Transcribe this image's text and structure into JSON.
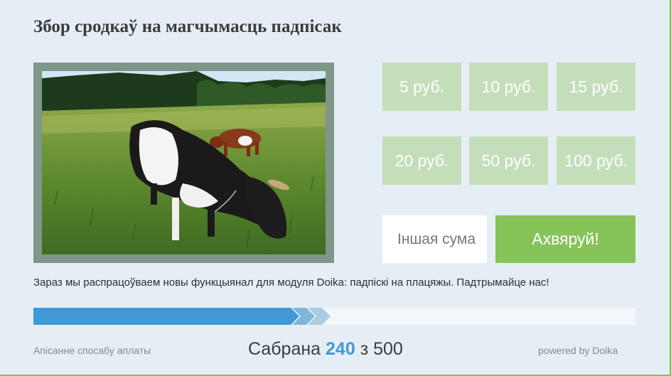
{
  "title": "Збор сродкаў на магчымасць падпісак",
  "photo": {
    "icon": "cow-photo"
  },
  "amounts": [
    "5 руб.",
    "10 руб.",
    "15 руб.",
    "20 руб.",
    "50 руб.",
    "100 руб."
  ],
  "other_amount": {
    "placeholder": "Іншая сума",
    "value": ""
  },
  "donate_label": "Ахвяруй!",
  "description": "Зараз мы распрацоўваем новы функцыянал для модуля Doika: падпіскі на плацяжы. Падтрымайце нас!",
  "progress": {
    "collected": "240",
    "goal": "500",
    "fraction": 0.48
  },
  "footer": {
    "payment_info": "Апісанне спосабу аплаты",
    "collected_prefix": "Сабрана",
    "collected_sep": "з",
    "powered": "powered by Doika"
  },
  "colors": {
    "background": "#e6eef5",
    "amount_button": "#c5deba",
    "donate_button": "#86c45a",
    "progress_fill": "#3f9ad6",
    "accent_text": "#3f9ad6"
  }
}
